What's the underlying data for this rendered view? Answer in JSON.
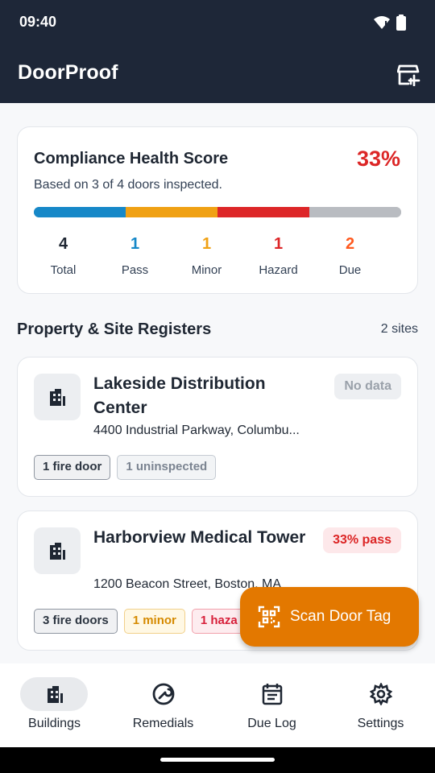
{
  "status": {
    "time": "09:40",
    "icons": [
      "wifi-icon",
      "battery-icon"
    ]
  },
  "app": {
    "title": "DoorProof",
    "action_icon": "add-store-icon"
  },
  "health": {
    "title": "Compliance Health Score",
    "score": "33%",
    "subtitle": "Based on 3 of 4 doors inspected.",
    "progress": [
      {
        "name": "pass",
        "fraction": 0.25,
        "color": "#1688c8"
      },
      {
        "name": "minor",
        "fraction": 0.25,
        "color": "#f0a114"
      },
      {
        "name": "hazard",
        "fraction": 0.25,
        "color": "#dd2628"
      },
      {
        "name": "uninspected",
        "fraction": 0.25,
        "color": "#b9bcc1"
      }
    ],
    "stats": [
      {
        "value": "4",
        "label": "Total",
        "color": "#1f2733"
      },
      {
        "value": "1",
        "label": "Pass",
        "color": "#1688c8"
      },
      {
        "value": "1",
        "label": "Minor",
        "color": "#f0a114"
      },
      {
        "value": "1",
        "label": "Hazard",
        "color": "#dd2628"
      },
      {
        "value": "2",
        "label": "Due",
        "color": "#ff5a1f"
      }
    ]
  },
  "registers": {
    "title": "Property & Site Registers",
    "count": "2 sites",
    "sites": [
      {
        "name": "Lakeside Distribution Center",
        "address": "4400 Industrial Parkway, Columbu...",
        "badge": "No data",
        "icon": "building-icon",
        "chips": [
          "1 fire door",
          "1 uninspected"
        ]
      },
      {
        "name": "Harborview Medical Tower",
        "address": "1200 Beacon Street, Boston, MA",
        "badge": "33% pass",
        "icon": "building-icon",
        "chips": [
          "3 fire doors",
          "1 minor",
          "1 haza"
        ]
      }
    ]
  },
  "fab": {
    "label": "Scan Door Tag",
    "icon": "qr-scan-icon"
  },
  "nav": {
    "items": [
      {
        "label": "Buildings",
        "icon": "building-icon",
        "selected": true
      },
      {
        "label": "Remedials",
        "icon": "wrench-icon",
        "selected": false
      },
      {
        "label": "Due Log",
        "icon": "calendar-log-icon",
        "selected": false
      },
      {
        "label": "Settings",
        "icon": "gear-icon",
        "selected": false
      }
    ]
  },
  "colors": {
    "header": "#1e2738",
    "accent": "#e37800",
    "danger": "#dc2626"
  }
}
